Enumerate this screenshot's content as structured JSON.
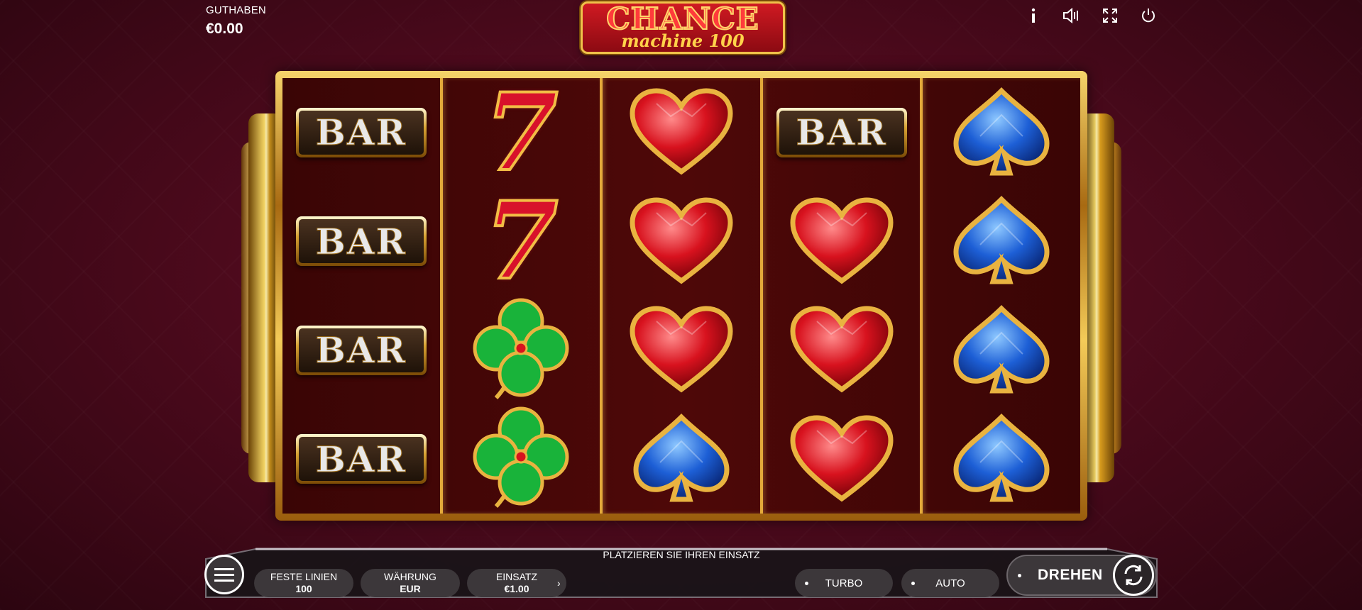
{
  "balance": {
    "label": "GUTHABEN",
    "value": "€0.00"
  },
  "logo": {
    "title": "CHANCE",
    "subtitle": "machine 100"
  },
  "top_icons": [
    "info-icon",
    "sound-icon",
    "fullscreen-icon",
    "power-icon"
  ],
  "reels": [
    [
      "bar",
      "bar",
      "bar",
      "bar"
    ],
    [
      "seven",
      "seven",
      "clover",
      "clover"
    ],
    [
      "heart",
      "heart",
      "heart",
      "spade"
    ],
    [
      "bar",
      "heart",
      "heart",
      "heart"
    ],
    [
      "spade",
      "spade",
      "spade",
      "spade"
    ]
  ],
  "symbols": {
    "bar_text": "BAR",
    "seven_text": "7"
  },
  "bottom": {
    "message": "PLATZIEREN SIE IHREN EINSATZ",
    "lines_label": "FESTE LINIEN",
    "lines_value": "100",
    "currency_label": "WÄHRUNG",
    "currency_value": "EUR",
    "bet_label": "EINSATZ",
    "bet_value": "€1.00",
    "turbo_label": "TURBO",
    "auto_label": "AUTO",
    "spin_label": "DREHEN"
  },
  "colors": {
    "heart": "#d8121e",
    "spade": "#1d5fd6",
    "clover": "#19b33a",
    "gold": "#f0c14a"
  }
}
